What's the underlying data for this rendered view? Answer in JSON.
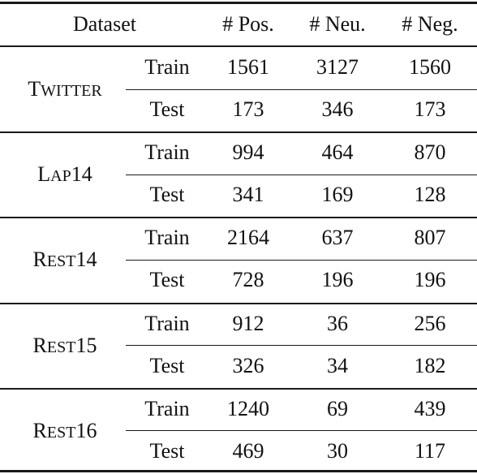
{
  "table": {
    "headers": [
      "Dataset",
      "# Pos.",
      "# Neu.",
      "# Neg."
    ],
    "groups": [
      {
        "name": "Twitter",
        "name_first": "T",
        "name_rest": "WITTER",
        "name_tail": "",
        "rows": [
          {
            "split": "Train",
            "pos": "1561",
            "neu": "3127",
            "neg": "1560"
          },
          {
            "split": "Test",
            "pos": "173",
            "neu": "346",
            "neg": "173"
          }
        ]
      },
      {
        "name": "Lap14",
        "name_first": "L",
        "name_rest": "AP",
        "name_tail": "14",
        "rows": [
          {
            "split": "Train",
            "pos": "994",
            "neu": "464",
            "neg": "870"
          },
          {
            "split": "Test",
            "pos": "341",
            "neu": "169",
            "neg": "128"
          }
        ]
      },
      {
        "name": "Rest14",
        "name_first": "R",
        "name_rest": "EST",
        "name_tail": "14",
        "rows": [
          {
            "split": "Train",
            "pos": "2164",
            "neu": "637",
            "neg": "807"
          },
          {
            "split": "Test",
            "pos": "728",
            "neu": "196",
            "neg": "196"
          }
        ]
      },
      {
        "name": "Rest15",
        "name_first": "R",
        "name_rest": "EST",
        "name_tail": "15",
        "rows": [
          {
            "split": "Train",
            "pos": "912",
            "neu": "36",
            "neg": "256"
          },
          {
            "split": "Test",
            "pos": "326",
            "neu": "34",
            "neg": "182"
          }
        ]
      },
      {
        "name": "Rest16",
        "name_first": "R",
        "name_rest": "EST",
        "name_tail": "16",
        "rows": [
          {
            "split": "Train",
            "pos": "1240",
            "neu": "69",
            "neg": "439"
          },
          {
            "split": "Test",
            "pos": "469",
            "neu": "30",
            "neg": "117"
          }
        ]
      }
    ]
  }
}
